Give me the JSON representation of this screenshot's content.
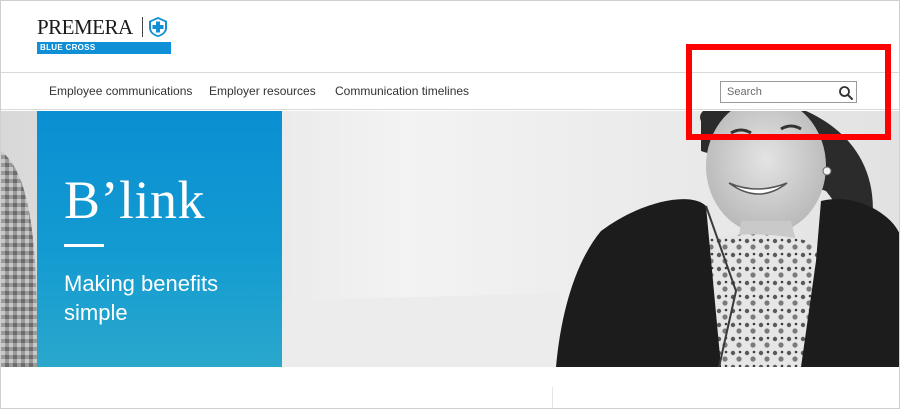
{
  "brand": {
    "name": "PREMERA",
    "tagline": "BLUE CROSS",
    "color": "#0f8fd6"
  },
  "nav": {
    "items": [
      {
        "label": "Employee communications"
      },
      {
        "label": "Employer resources"
      },
      {
        "label": "Communication timelines"
      }
    ]
  },
  "search": {
    "placeholder": "Search",
    "icon": "magnifier-icon"
  },
  "hero": {
    "title": "B’link",
    "subtitle": "Making benefits simple",
    "panel_color": "#0a8fd2",
    "image": "black-and-white photo of smiling woman in blazer"
  },
  "annotation": {
    "color": "#ff0000",
    "target": "search-box"
  }
}
